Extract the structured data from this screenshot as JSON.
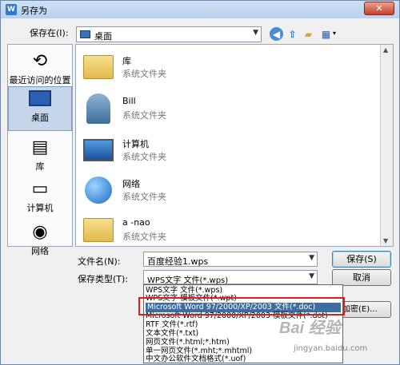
{
  "window": {
    "title": "另存为",
    "app_icon_letter": "W",
    "close_label": "✕"
  },
  "toolbar": {
    "savein_label": "保存在(I):",
    "savein_value": "桌面",
    "views_arrow": "▾"
  },
  "places": [
    {
      "label": "最近访问的位置"
    },
    {
      "label": "桌面"
    },
    {
      "label": "库"
    },
    {
      "label": "计算机"
    },
    {
      "label": "网络"
    }
  ],
  "files": [
    {
      "name": "库",
      "type": "系统文件夹"
    },
    {
      "name": "Bill",
      "type": "系统文件夹"
    },
    {
      "name": "计算机",
      "type": "系统文件夹"
    },
    {
      "name": "网络",
      "type": "系统文件夹"
    },
    {
      "name": "a -nao",
      "type": "系统文件夹"
    }
  ],
  "form": {
    "filename_label": "文件名(N):",
    "filename_value": "百度经验1.wps",
    "savetype_label": "保存类型(T):",
    "savetype_value": "WPS文字 文件(*.wps)"
  },
  "buttons": {
    "save": "保存(S)",
    "cancel": "取消",
    "encrypt": "加密(E)..."
  },
  "dropdown_options": [
    "WPS文字 文件(*.wps)",
    "WPS文字 模板文件(*.wpt)",
    "Microsoft Word 97/2000/XP/2003 文件(*.doc)",
    "Microsoft Word 97/2000/XP/2003 模板文件(*.dot)",
    "RTF 文件(*.rtf)",
    "文本文件(*.txt)",
    "网页文件(*.html;*.htm)",
    "单一网页文件(*.mht;*.mhtml)",
    "中文办公软件文档格式(*.uof)"
  ],
  "selected_option_index": 2,
  "watermark": {
    "logo": "Bai 经验",
    "site": "jingyan.baidu.com"
  },
  "colors": {
    "accent": "#3a6ea5",
    "highlight_border": "#d81f1f",
    "title_bar": "#b9d1ee"
  }
}
